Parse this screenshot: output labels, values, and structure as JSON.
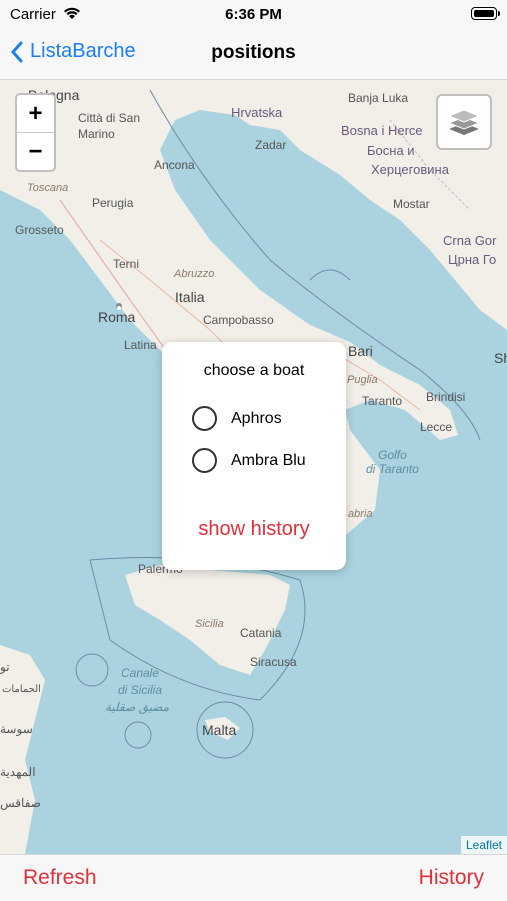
{
  "status": {
    "carrier": "Carrier",
    "time": "6:36 PM"
  },
  "nav": {
    "back_label": "ListaBarche",
    "title": "positions"
  },
  "map": {
    "zoom_in": "+",
    "zoom_out": "−",
    "attribution": "Leaflet",
    "labels": {
      "bologna": "Bologna",
      "san_marino": "Città di San\nMarino",
      "ancona": "Ancona",
      "toscana": "Toscana",
      "perugia": "Perugia",
      "grosseto": "Grosseto",
      "terni": "Terni",
      "abruzzo": "Abruzzo",
      "italia": "Italia",
      "roma": "Roma",
      "campobasso": "Campobasso",
      "latina": "Latina",
      "hrvatska": "Hrvatska",
      "zadar": "Zadar",
      "banja_luka": "Banja Luka",
      "bosna": "Bosna i Herce",
      "bosna_cyr": "Босна и",
      "herceg_cyr": "Херцеговина",
      "mostar": "Mostar",
      "crna_gora": "Crna Gor",
      "crna_gora_cyr": "Црна Го",
      "bari": "Bari",
      "puglia": "Puglia",
      "taranto": "Taranto",
      "brindisi": "Brindisi",
      "lecce": "Lecce",
      "golfo": "Golfo\ndi Taranto",
      "calabria": "abria",
      "palermo": "Palermo",
      "sicilia": "Sicilia",
      "catania": "Catania",
      "siracusa": "Siracusa",
      "canale": "Canale\ndi Sicilia",
      "canale_ar": "مضيق صقلية",
      "malta": "Malta",
      "sh": "Sh",
      "tu": "تو",
      "hammamet": "الحمامات",
      "sousse": "سوسة",
      "mahdia": "المهدية",
      "sfax": "صفاقس"
    }
  },
  "popup": {
    "title": "choose a boat",
    "options": [
      "Aphros",
      "Ambra Blu"
    ],
    "action": "show history"
  },
  "toolbar": {
    "left": "Refresh",
    "right": "History"
  },
  "colors": {
    "accent_blue": "#1a7ef7",
    "accent_red": "#e0303a",
    "sea": "#aad3df",
    "land": "#f2efe9"
  }
}
